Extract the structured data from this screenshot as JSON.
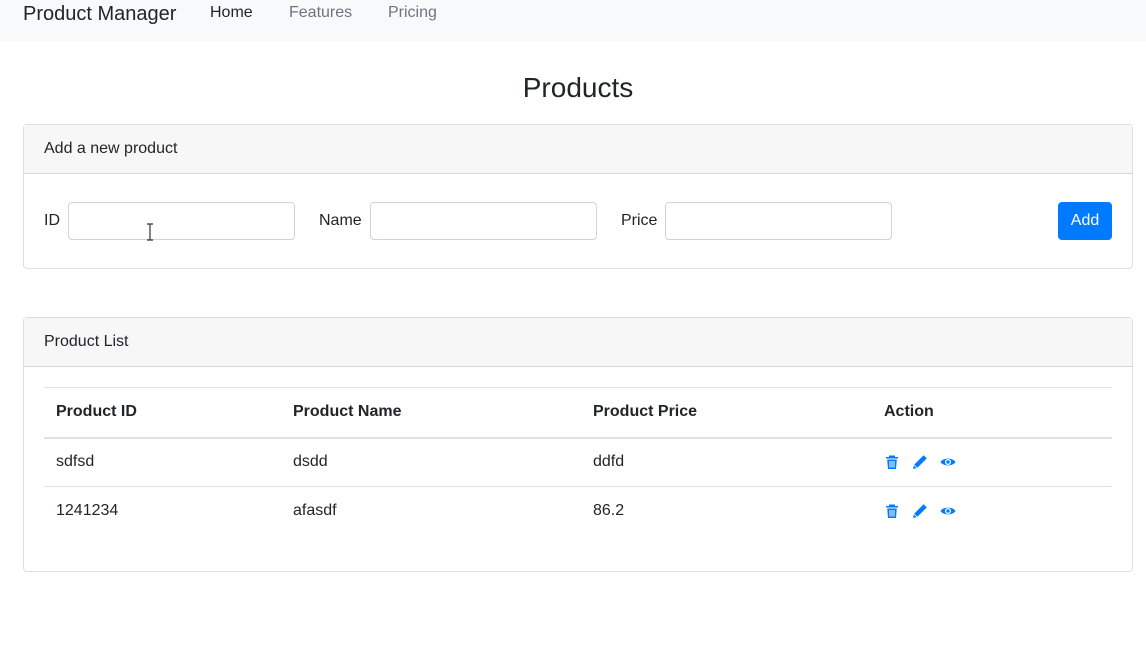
{
  "navbar": {
    "brand": "Product Manager",
    "links": [
      {
        "label": "Home",
        "active": true
      },
      {
        "label": "Features",
        "active": false
      },
      {
        "label": "Pricing",
        "active": false
      }
    ]
  },
  "page": {
    "title": "Products"
  },
  "add_form": {
    "header": "Add a new product",
    "fields": [
      {
        "label": "ID",
        "value": "",
        "placeholder": ""
      },
      {
        "label": "Name",
        "value": "",
        "placeholder": ""
      },
      {
        "label": "Price",
        "value": "",
        "placeholder": ""
      }
    ],
    "submit_label": "Add"
  },
  "product_list": {
    "header": "Product List",
    "columns": [
      "Product ID",
      "Product Name",
      "Product Price",
      "Action"
    ],
    "rows": [
      {
        "id": "sdfsd",
        "name": "dsdd",
        "price": "ddfd"
      },
      {
        "id": "1241234",
        "name": "afasdf",
        "price": "86.2"
      }
    ],
    "action_icons": [
      "trash-icon",
      "pencil-icon",
      "eye-icon"
    ]
  },
  "colors": {
    "primary": "#007bff",
    "navbar_bg": "#f8f9fa",
    "card_header_bg": "#f7f7f7",
    "muted_link": "#6c757d"
  }
}
